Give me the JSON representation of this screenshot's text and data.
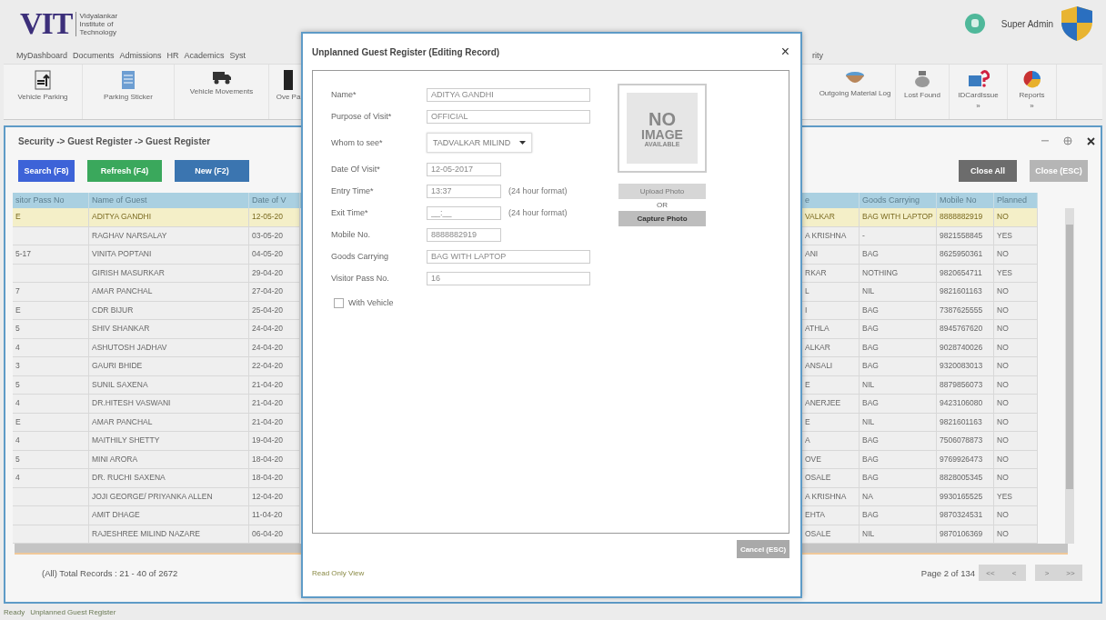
{
  "header": {
    "logo": "VIT",
    "logo_subtitle": "Vidyalankar Institute of Technology",
    "user": "Super Admin"
  },
  "menu_left": [
    "MyDashboard",
    "Documents",
    "Admissions",
    "HR",
    "Academics",
    "Syst"
  ],
  "menu_right": [
    "rity"
  ],
  "toolbar_left": [
    {
      "label": "Vehicle Parking",
      "kind": "parking"
    },
    {
      "label": "Parking Sticker",
      "kind": "sticker"
    },
    {
      "label": "Vehicle Movements",
      "kind": "truck"
    },
    {
      "label": "Ove Pa",
      "kind": "phone"
    }
  ],
  "toolbar_right": [
    {
      "label": "Outgoing Material Log",
      "kind": "bowl"
    },
    {
      "label": "Lost Found",
      "kind": "bag"
    },
    {
      "label": "IDCardIssue",
      "kind": "card",
      "more": "»"
    },
    {
      "label": "Reports",
      "kind": "pie",
      "more": "»"
    }
  ],
  "panel": {
    "breadcrumb": "Security -> Guest Register -> Guest Register",
    "buttons": [
      {
        "label": "Search (F8)",
        "kind": "search"
      },
      {
        "label": "Refresh (F4)",
        "kind": "refresh"
      },
      {
        "label": "New (F2)",
        "kind": "new"
      }
    ],
    "right_buttons": [
      {
        "label": "Close All",
        "disabled": false
      },
      {
        "label": "Close (ESC)",
        "disabled": true
      }
    ],
    "columns_left": [
      "sitor Pass No",
      "Name of Guest",
      "Date of V"
    ],
    "columns_right": [
      "e",
      "Goods Carrying",
      "Mobile No",
      "Planned"
    ],
    "rows": [
      {
        "selected": true,
        "cells": [
          "E",
          "ADITYA GANDHI",
          "12-05-20",
          "VALKAR",
          "BAG WITH LAPTOP",
          "8888882919",
          "NO"
        ]
      },
      {
        "selected": false,
        "cells": [
          "",
          "RAGHAV NARSALAY",
          "03-05-20",
          "A KRISHNA",
          "-",
          "9821558845",
          "YES"
        ]
      },
      {
        "selected": false,
        "cells": [
          "5-17",
          "VINITA POPTANI",
          "04-05-20",
          "ANI",
          "BAG",
          "8625950361",
          "NO"
        ]
      },
      {
        "selected": false,
        "cells": [
          "",
          "GIRISH MASURKAR",
          "29-04-20",
          "RKAR",
          "NOTHING",
          "9820654711",
          "YES"
        ]
      },
      {
        "selected": false,
        "cells": [
          "7",
          "AMAR PANCHAL",
          "27-04-20",
          "L",
          "NIL",
          "9821601163",
          "NO"
        ]
      },
      {
        "selected": false,
        "cells": [
          "E",
          "CDR BIJUR",
          "25-04-20",
          "I",
          "BAG",
          "7387625555",
          "NO"
        ]
      },
      {
        "selected": false,
        "cells": [
          "5",
          "SHIV SHANKAR",
          "24-04-20",
          "ATHLA",
          "BAG",
          "8945767620",
          "NO"
        ]
      },
      {
        "selected": false,
        "cells": [
          "4",
          "ASHUTOSH JADHAV",
          "24-04-20",
          "ALKAR",
          "BAG",
          "9028740026",
          "NO"
        ]
      },
      {
        "selected": false,
        "cells": [
          "3",
          "GAURI BHIDE",
          "22-04-20",
          "ANSALI",
          "BAG",
          "9320083013",
          "NO"
        ]
      },
      {
        "selected": false,
        "cells": [
          "5",
          "SUNIL SAXENA",
          "21-04-20",
          "E",
          "NIL",
          "8879856073",
          "NO"
        ]
      },
      {
        "selected": false,
        "cells": [
          "4",
          "DR.HITESH VASWANI",
          "21-04-20",
          "ANERJEE",
          "BAG",
          "9423106080",
          "NO"
        ]
      },
      {
        "selected": false,
        "cells": [
          "E",
          "AMAR PANCHAL",
          "21-04-20",
          "E",
          "NIL",
          "9821601163",
          "NO"
        ]
      },
      {
        "selected": false,
        "cells": [
          "4",
          "MAITHILY SHETTY",
          "19-04-20",
          "A",
          "BAG",
          "7506078873",
          "NO"
        ]
      },
      {
        "selected": false,
        "cells": [
          "5",
          "MINI ARORA",
          "18-04-20",
          "OVE",
          "BAG",
          "9769926473",
          "NO"
        ]
      },
      {
        "selected": false,
        "cells": [
          "4",
          "DR. RUCHI SAXENA",
          "18-04-20",
          "OSALE",
          "BAG",
          "8828005345",
          "NO"
        ]
      },
      {
        "selected": false,
        "cells": [
          "",
          "JOJI GEORGE/ PRIYANKA ALLEN",
          "12-04-20",
          "A KRISHNA",
          "NA",
          "9930165525",
          "YES"
        ]
      },
      {
        "selected": false,
        "cells": [
          "",
          "AMIT DHAGE",
          "11-04-20",
          "EHTA",
          "BAG",
          "9870324531",
          "NO"
        ]
      },
      {
        "selected": false,
        "cells": [
          "",
          "RAJESHREE MILIND NAZARE",
          "06-04-20",
          "OSALE",
          "NIL",
          "9870106369",
          "NO"
        ]
      }
    ],
    "total": "(All) Total Records : 21 - 40 of 2672",
    "page": "Page 2 of 134",
    "pager": [
      "<<",
      "<",
      ">",
      ">>"
    ]
  },
  "status_bar": [
    "Ready",
    "Unplanned Guest Register"
  ],
  "dialog": {
    "title": "Unplanned Guest Register (Editing Record)",
    "close": "×",
    "fields": [
      {
        "label": "Name*",
        "value": "ADITYA GANDHI",
        "kind": "wide"
      },
      {
        "label": "Purpose of Visit*",
        "value": "OFFICIAL",
        "kind": "wide"
      },
      {
        "label": "Whom to see*",
        "value": "TADVALKAR MILIND",
        "kind": "select"
      },
      {
        "label": "Date Of Visit*",
        "value": "12-05-2017",
        "kind": "short"
      },
      {
        "label": "Entry Time*",
        "value": "13:37",
        "kind": "time",
        "hint": "(24 hour format)"
      },
      {
        "label": "Exit Time*",
        "value": "__:__",
        "kind": "time",
        "hint": "(24 hour format)"
      },
      {
        "label": "Mobile No.",
        "value": "8888882919",
        "kind": "short"
      },
      {
        "label": "Goods Carrying",
        "value": "BAG WITH LAPTOP",
        "kind": "wide"
      },
      {
        "label": "Visitor Pass No.",
        "value": "16",
        "kind": "wide"
      }
    ],
    "checkbox": {
      "label": "With Vehicle",
      "checked": false
    },
    "photo": {
      "text": [
        "NO",
        "IMAGE",
        "AVAILABLE"
      ]
    },
    "upload": {
      "label": "Upload Photo",
      "disabled": true
    },
    "or": "OR",
    "capture": {
      "label": "Capture Photo",
      "disabled": false
    },
    "cancel": {
      "label": "Cancel (ESC)",
      "disabled": true
    },
    "footer": "Read Only View"
  }
}
